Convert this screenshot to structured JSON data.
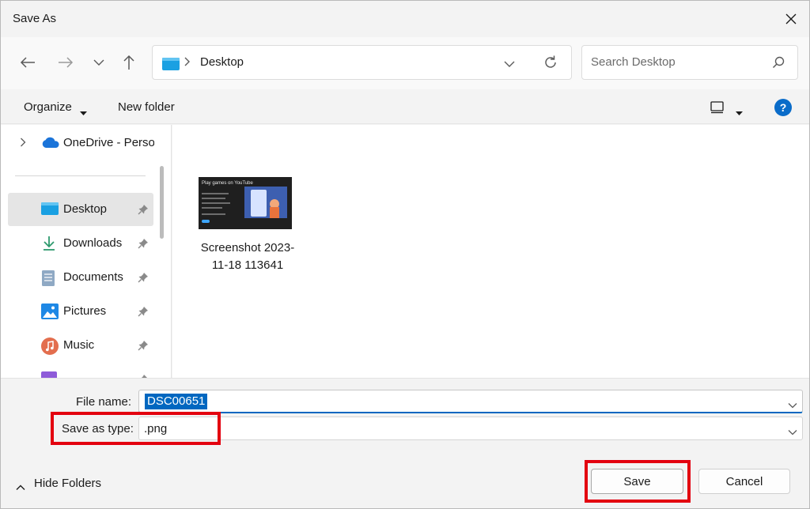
{
  "window": {
    "title": "Save As"
  },
  "nav": {
    "address_path": "Desktop",
    "search_placeholder": "Search Desktop"
  },
  "toolbar": {
    "organize_label": "Organize",
    "new_folder_label": "New folder"
  },
  "sidebar": {
    "onedrive_label": "OneDrive - Perso",
    "items": [
      {
        "label": "Desktop",
        "icon": "desktop-folder-icon",
        "pinned": true,
        "selected": true
      },
      {
        "label": "Downloads",
        "icon": "downloads-icon",
        "pinned": true
      },
      {
        "label": "Documents",
        "icon": "documents-icon",
        "pinned": true
      },
      {
        "label": "Pictures",
        "icon": "pictures-icon",
        "pinned": true
      },
      {
        "label": "Music",
        "icon": "music-icon",
        "pinned": true
      }
    ]
  },
  "content": {
    "files": [
      {
        "name": "Screenshot 2023-11-18 113641",
        "thumbnail_title": "Play games on YouTube"
      }
    ]
  },
  "form": {
    "file_name_label": "File name:",
    "file_name_value": "DSC00651",
    "save_type_label": "Save as type:",
    "save_type_value": ".png"
  },
  "footer": {
    "hide_folders_label": "Hide Folders",
    "save_label": "Save",
    "cancel_label": "Cancel"
  },
  "colors": {
    "accent": "#0067c0",
    "highlight_box": "#e3000f",
    "help_icon": "#0a6cc9",
    "onedrive": "#1b74d9"
  }
}
